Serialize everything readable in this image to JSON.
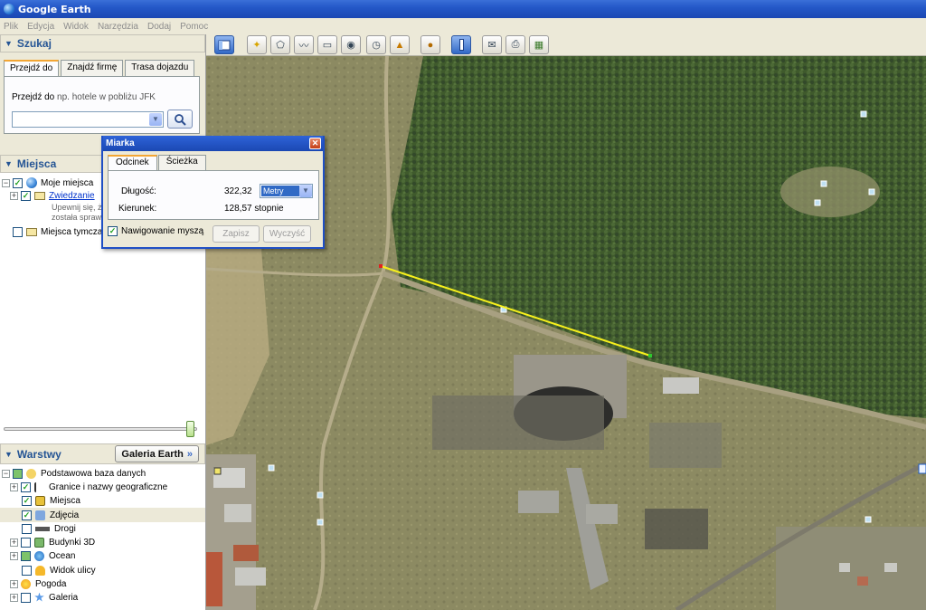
{
  "window": {
    "title": "Google Earth"
  },
  "menu": [
    "Plik",
    "Edycja",
    "Widok",
    "Narzędzia",
    "Dodaj",
    "Pomoc"
  ],
  "search": {
    "header": "Szukaj",
    "tabs": [
      "Przejdź do",
      "Znajdź firmę",
      "Trasa dojazdu"
    ],
    "goto_label": "Przejdź do",
    "goto_hint": "np. hotele w pobliżu JFK",
    "input_value": ""
  },
  "places": {
    "header": "Miejsca",
    "items": [
      {
        "label": "Moje miejsca"
      },
      {
        "label": "Zwiedzanie"
      },
      {
        "label": "Upewnij się, ż"
      },
      {
        "label": "została spraw"
      },
      {
        "label": "Miejsca tymczas"
      }
    ]
  },
  "layers": {
    "header": "Warstwy",
    "gallery_label": "Galeria Earth",
    "gallery_arrow": "»",
    "items": [
      {
        "label": "Podstawowa baza danych",
        "checked": true
      },
      {
        "label": "Granice i nazwy geograficzne",
        "checked": true
      },
      {
        "label": "Miejsca",
        "checked": true
      },
      {
        "label": "Zdjęcia",
        "checked": true
      },
      {
        "label": "Drogi",
        "checked": false
      },
      {
        "label": "Budynki 3D",
        "checked": false
      },
      {
        "label": "Ocean",
        "checked": false
      },
      {
        "label": "Widok ulicy",
        "checked": false
      },
      {
        "label": "Pogoda",
        "checked": false
      },
      {
        "label": "Galeria",
        "checked": false
      }
    ]
  },
  "ruler": {
    "title": "Miarka",
    "close": "✕",
    "tabs": [
      "Odcinek",
      "Ścieżka"
    ],
    "length_label": "Długość:",
    "length_value": "322,32",
    "unit": "Metry",
    "heading_label": "Kierunek:",
    "heading_value": "128,57 stopnie",
    "mouse_nav_label": "Nawigowanie myszą",
    "mouse_nav_checked": true,
    "save_label": "Zapisz",
    "clear_label": "Wyczyść"
  },
  "colors": {
    "measure_line": "#f7f01c",
    "title_bar": "#2458c8",
    "section_header_text": "#245494"
  }
}
